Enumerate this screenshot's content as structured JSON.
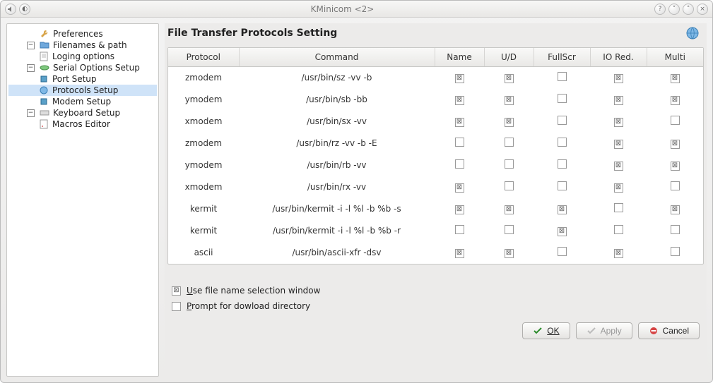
{
  "window": {
    "title": "KMinicom <2>"
  },
  "sidebar": {
    "items": [
      {
        "label": "Preferences",
        "expandable": false
      },
      {
        "label": "Filenames & path",
        "expandable": true
      },
      {
        "label": "Loging options",
        "child": true
      },
      {
        "label": "Serial Options Setup",
        "expandable": true
      },
      {
        "label": "Port Setup",
        "child": true
      },
      {
        "label": "Protocols Setup",
        "child": true,
        "selected": true
      },
      {
        "label": "Modem Setup",
        "child": true
      },
      {
        "label": "Keyboard Setup",
        "expandable": true
      },
      {
        "label": "Macros Editor",
        "child": true
      }
    ]
  },
  "page": {
    "heading": "File Transfer Protocols Setting",
    "columns": [
      "Protocol",
      "Command",
      "Name",
      "U/D",
      "FullScr",
      "IO Red.",
      "Multi"
    ],
    "rows": [
      {
        "protocol": "zmodem",
        "command": "/usr/bin/sz -vv -b",
        "name": true,
        "ud": true,
        "fullscr": false,
        "iored": true,
        "multi": true
      },
      {
        "protocol": "ymodem",
        "command": "/usr/bin/sb -bb",
        "name": true,
        "ud": true,
        "fullscr": false,
        "iored": true,
        "multi": true
      },
      {
        "protocol": "xmodem",
        "command": "/usr/bin/sx -vv",
        "name": true,
        "ud": true,
        "fullscr": false,
        "iored": true,
        "multi": false
      },
      {
        "protocol": "zmodem",
        "command": "/usr/bin/rz -vv -b -E",
        "name": false,
        "ud": false,
        "fullscr": false,
        "iored": true,
        "multi": true
      },
      {
        "protocol": "ymodem",
        "command": "/usr/bin/rb -vv",
        "name": false,
        "ud": false,
        "fullscr": false,
        "iored": true,
        "multi": true
      },
      {
        "protocol": "xmodem",
        "command": "/usr/bin/rx -vv",
        "name": true,
        "ud": false,
        "fullscr": false,
        "iored": true,
        "multi": false
      },
      {
        "protocol": "kermit",
        "command": "/usr/bin/kermit -i -l %l -b %b -s",
        "name": true,
        "ud": true,
        "fullscr": true,
        "iored": false,
        "multi": true
      },
      {
        "protocol": "kermit",
        "command": "/usr/bin/kermit -i -l %l -b %b -r",
        "name": false,
        "ud": false,
        "fullscr": true,
        "iored": false,
        "multi": false
      },
      {
        "protocol": "ascii",
        "command": "/usr/bin/ascii-xfr -dsv",
        "name": true,
        "ud": true,
        "fullscr": false,
        "iored": true,
        "multi": false
      }
    ],
    "opt_use_selection": {
      "label_pre": "U",
      "label_rest": "se file name selection window",
      "checked": true
    },
    "opt_prompt_dir": {
      "label_pre": "P",
      "label_rest": "rompt for dowload directory",
      "checked": false
    }
  },
  "buttons": {
    "ok": "OK",
    "apply": "Apply",
    "cancel": "Cancel"
  }
}
